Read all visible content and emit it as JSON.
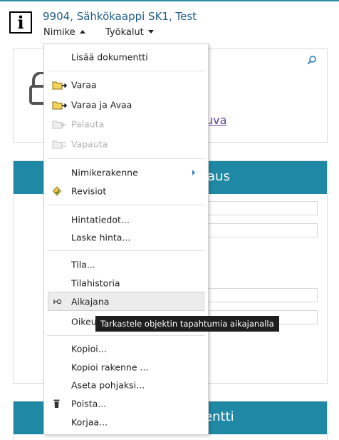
{
  "header": {
    "title": "9904, Sähkökaappi SK1, Test",
    "menubar": {
      "nimike": "Nimike",
      "tyokalut": "Työkalut"
    }
  },
  "panels": {
    "link_text": "uva",
    "header2_text": "aus",
    "header3_text": "entti"
  },
  "menu": {
    "items": {
      "lisaa_dokumentti": "Lisää dokumentti",
      "varaa": "Varaa",
      "varaa_ja_avaa": "Varaa ja Avaa",
      "palauta": "Palauta",
      "vapauta": "Vapauta",
      "nimikerakenne": "Nimikerakenne",
      "revisiot": "Revisiot",
      "hintatiedot": "Hintatiedot...",
      "laske_hinta": "Laske hinta...",
      "tila": "Tila...",
      "tilahistoria": "Tilahistoria",
      "aikajana": "Aikajana",
      "oikeudet": "Oikeu",
      "kopioi": "Kopioi...",
      "kopioi_rakenne": "Kopioi rakenne ...",
      "aseta_pohjaksi": "Aseta pohjaksi...",
      "poista": "Poista...",
      "korjaa": "Korjaa..."
    }
  },
  "tooltip": {
    "text": "Tarkastele objektin tapahtumia aikajanalla"
  },
  "colors": {
    "accent": "#1f88a4",
    "title": "#1f5d86",
    "link": "#5b3f99",
    "disabled": "#b4b4b4"
  }
}
